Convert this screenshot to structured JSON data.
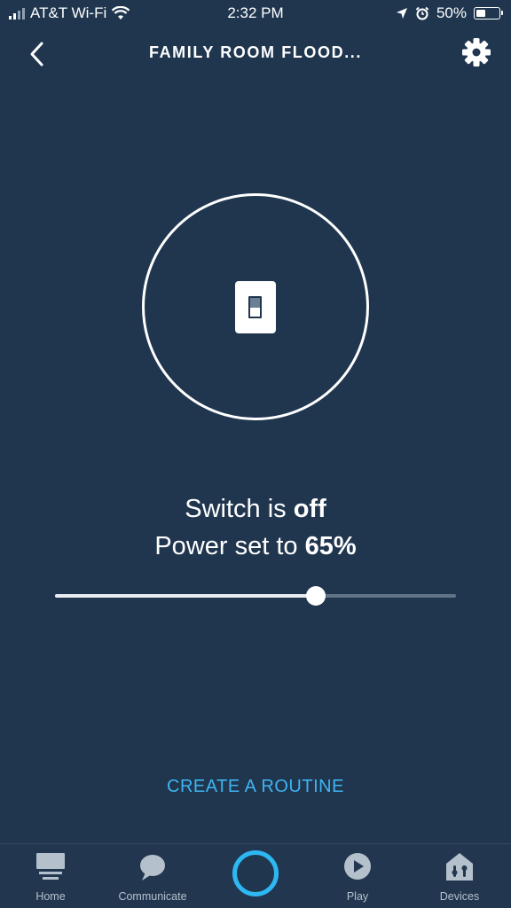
{
  "status_bar": {
    "carrier": "AT&T Wi-Fi",
    "time": "2:32 PM",
    "battery_percent": "50%",
    "battery_level": 0.5
  },
  "header": {
    "title": "FAMILY ROOM FLOOD..."
  },
  "device": {
    "switch_state_prefix": "Switch is ",
    "switch_state": "off",
    "power_prefix": "Power set to ",
    "power_value": "65%",
    "power_level": 0.65
  },
  "actions": {
    "create_routine": "CREATE A ROUTINE"
  },
  "nav": {
    "items": [
      {
        "label": "Home",
        "icon": "home-icon"
      },
      {
        "label": "Communicate",
        "icon": "chat-bubble-icon"
      },
      {
        "label": "",
        "icon": "alexa-ring-icon"
      },
      {
        "label": "Play",
        "icon": "play-icon"
      },
      {
        "label": "Devices",
        "icon": "devices-icon"
      }
    ]
  },
  "colors": {
    "background": "#20364f",
    "accent": "#3fb4f0",
    "alexa": "#2db8f2"
  }
}
